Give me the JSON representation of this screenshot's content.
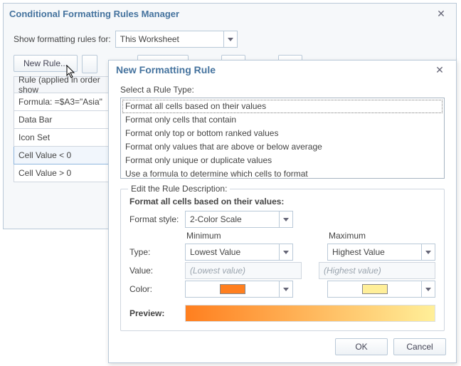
{
  "manager": {
    "title": "Conditional Formatting Rules Manager",
    "show_rules_label": "Show formatting rules for:",
    "show_rules_value": "This Worksheet",
    "toolbar": {
      "new_rule": "New Rule..."
    },
    "list_header": "Rule (applied in order show",
    "rules": [
      {
        "label": "Formula: =$A3=\"Asia\""
      },
      {
        "label": "Data Bar"
      },
      {
        "label": "Icon Set"
      },
      {
        "label": "Cell Value < 0",
        "selected": true
      },
      {
        "label": "Cell Value > 0"
      }
    ]
  },
  "modal": {
    "title": "New Formatting Rule",
    "select_type_label": "Select a Rule Type:",
    "rule_types": [
      "Format all cells based on their values",
      "Format only cells that contain",
      "Format only top or bottom ranked values",
      "Format only values that are above or below average",
      "Format only unique or duplicate values",
      "Use a formula to determine which cells to format"
    ],
    "selected_rule_type_index": 0,
    "edit_legend": "Edit the Rule Description:",
    "desc_title": "Format all cells based on their values:",
    "format_style_label": "Format style:",
    "format_style_value": "2-Color Scale",
    "min_header": "Minimum",
    "max_header": "Maximum",
    "type_label": "Type:",
    "min_type": "Lowest Value",
    "max_type": "Highest Value",
    "value_label": "Value:",
    "min_value_placeholder": "(Lowest value)",
    "max_value_placeholder": "(Highest value)",
    "color_label": "Color:",
    "min_color": "#ff7f1f",
    "max_color": "#ffef99",
    "preview_label": "Preview:",
    "ok": "OK",
    "cancel": "Cancel"
  }
}
